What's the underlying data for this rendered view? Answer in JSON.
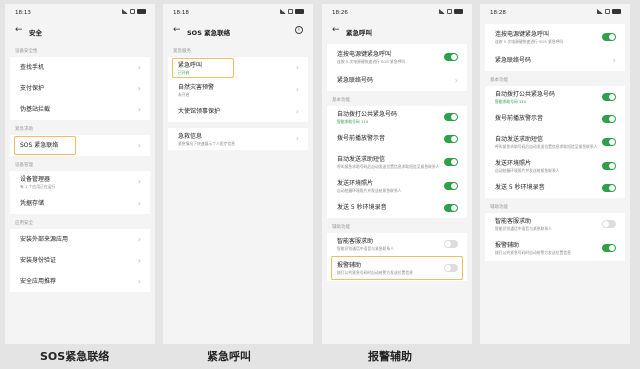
{
  "accent_color": "#2ea04a",
  "highlight_color": "#f0c060",
  "phones": [
    {
      "time": "18:13",
      "title": "安全",
      "sections": [
        {
          "label": "设备安全性",
          "rows": [
            {
              "label": "查找手机",
              "type": "chev"
            },
            {
              "label": "支付保护",
              "type": "chev"
            },
            {
              "label": "伪基站拦截",
              "type": "chev"
            }
          ]
        },
        {
          "label": "紧急求助",
          "rows": [
            {
              "label": "SOS 紧急联络",
              "type": "chev",
              "highlight": true
            }
          ]
        },
        {
          "label": "设备管理",
          "rows": [
            {
              "label": "设备管理器",
              "sub": "有 1 个应用正在运行",
              "type": "chev"
            },
            {
              "label": "凭据存储",
              "type": "chev"
            }
          ]
        },
        {
          "label": "应用安全",
          "rows": [
            {
              "label": "安装外部来源应用",
              "type": "chev"
            },
            {
              "label": "安装身份验证",
              "type": "chev"
            },
            {
              "label": "安全应用推荐",
              "type": "chev"
            }
          ]
        }
      ],
      "caption": "SOS紧急联络"
    },
    {
      "time": "18:18",
      "title": "SOS 紧急联络",
      "sections": [
        {
          "label": "紧急服务",
          "rows": [
            {
              "label": "紧急呼叫",
              "sub": "已开启",
              "subGreen": true,
              "type": "chev",
              "highlight": true
            },
            {
              "label": "自然灾害预警",
              "sub": "未开启",
              "type": "chev"
            },
            {
              "label": "大使馆领事保护",
              "type": "chev"
            }
          ]
        },
        {
          "label": "",
          "rows": [
            {
              "label": "急救信息",
              "sub": "紧急情况下快速展示个人医疗信息",
              "type": "chev"
            }
          ]
        }
      ],
      "caption": "紧急呼叫"
    },
    {
      "time": "18:26",
      "title": "紧急呼叫",
      "sections": [
        {
          "label": "",
          "rows": [
            {
              "label": "连按电源键紧急呼叫",
              "sub": "连按 5 次电源键快速进行 SOS 紧急呼叫",
              "type": "on"
            },
            {
              "label": "紧急联络号码",
              "type": "chev"
            }
          ]
        },
        {
          "label": "基本功能",
          "rows": [
            {
              "label": "自动拨打公共紧急号码",
              "sub": "智能求助号码 110",
              "subGreen": true,
              "type": "on"
            },
            {
              "label": "拨号前播放警示音",
              "type": "on"
            },
            {
              "label": "自动发送求助短信",
              "sub": "呼叫紧急求助号码后自动发送位置信息求助短信至紧急联系人",
              "type": "on"
            },
            {
              "label": "发送环境照片",
              "sub": "自动拍摄环境照片并发送给紧急联系人",
              "type": "on"
            },
            {
              "label": "发送 5 秒环境录音",
              "type": "on"
            }
          ]
        },
        {
          "label": "辅助功能",
          "rows": [
            {
              "label": "智能客服求助",
              "sub": "智能识别通话中语音与紧急联系人",
              "type": "off"
            },
            {
              "label": "报警辅助",
              "sub": "拨打公共紧急号码时自动给警方发送位置信息",
              "type": "off",
              "highlight": true
            }
          ]
        }
      ],
      "caption": "报警辅助"
    },
    {
      "time": "18:28",
      "title": "紧急呼叫",
      "sections": [
        {
          "label": "",
          "rows": [
            {
              "label": "连按电源键紧急呼叫",
              "sub": "连按 5 次电源键快速进行 SOS 紧急呼叫",
              "type": "on"
            },
            {
              "label": "紧急联络号码",
              "type": "chev"
            }
          ]
        },
        {
          "label": "基本功能",
          "rows": [
            {
              "label": "自动拨打公共紧急号码",
              "sub": "智能求助号码 110",
              "subGreen": true,
              "type": "on"
            },
            {
              "label": "拨号前播放警示音",
              "type": "on"
            },
            {
              "label": "自动发送求助短信",
              "sub": "呼叫紧急求助号码后自动发送位置信息求助短信至紧急联系人",
              "type": "on"
            },
            {
              "label": "发送环境照片",
              "sub": "自动拍摄环境照片并发送给紧急联系人",
              "type": "on"
            },
            {
              "label": "发送 5 秒环境录音",
              "type": "on"
            }
          ]
        },
        {
          "label": "辅助功能",
          "rows": [
            {
              "label": "智能客服求助",
              "sub": "智能识别通话中语音与紧急联系人",
              "type": "off"
            },
            {
              "label": "报警辅助",
              "sub": "拨打公共紧急号码时自动给警方发送位置信息",
              "type": "on"
            }
          ]
        }
      ],
      "caption": ""
    }
  ]
}
